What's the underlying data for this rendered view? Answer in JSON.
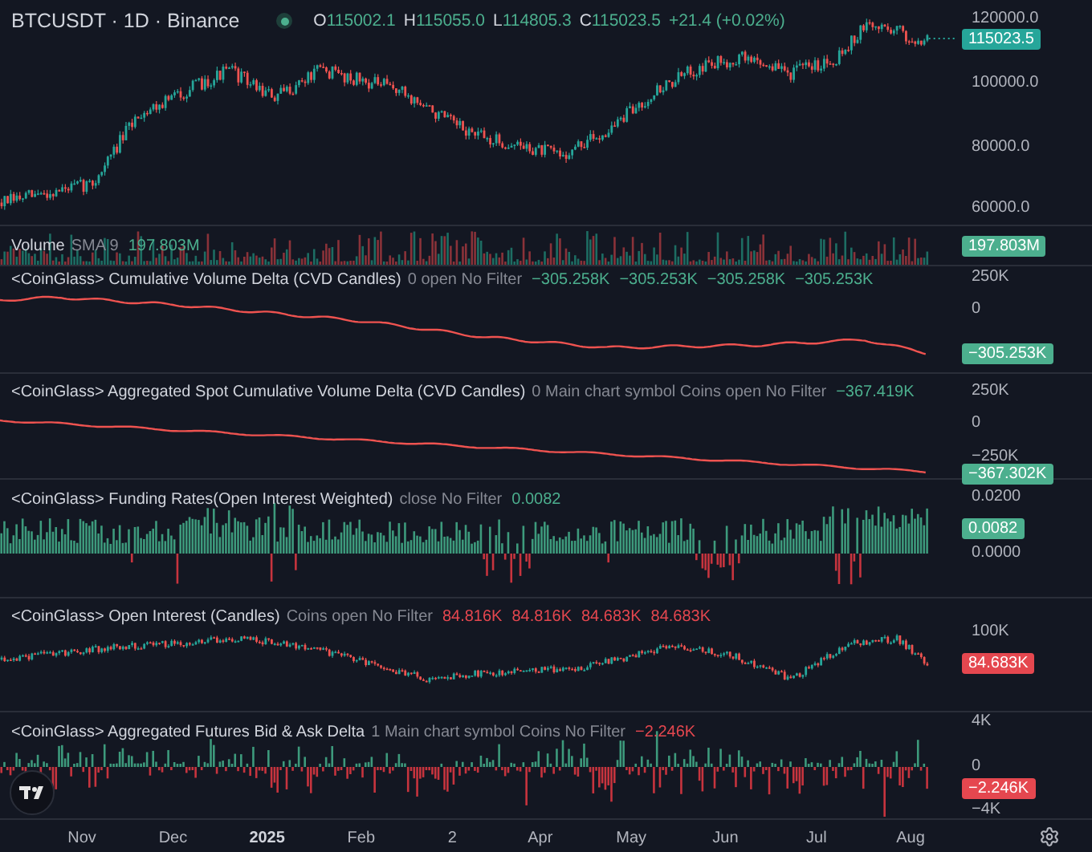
{
  "symbol": {
    "title": "BTCUSDT · 1D · Binance",
    "live": true,
    "ohlc": [
      {
        "label": "O",
        "value": "115002.1"
      },
      {
        "label": "H",
        "value": "115055.0"
      },
      {
        "label": "L",
        "value": "114805.3"
      },
      {
        "label": "C",
        "value": "115023.5"
      }
    ],
    "change": "+21.4 (+0.02%)",
    "color": "#4caf8e"
  },
  "price_axis": {
    "ticks": [
      "120000.0",
      "100000.0",
      "80000.0",
      "60000.0"
    ],
    "last_price": "115023.5"
  },
  "panes": [
    {
      "kind": "volume",
      "name": "Volume",
      "params": "SMA 9",
      "values": [
        "197.803M"
      ],
      "color": "#4caf8e",
      "badge": "197.803M"
    },
    {
      "kind": "cvd",
      "name": "<CoinGlass> Cumulative Volume Delta (CVD Candles)",
      "params": "0 open No Filter",
      "values": [
        "−305.258K",
        "−305.253K",
        "−305.258K",
        "−305.253K"
      ],
      "color": "#4caf8e",
      "ticks": [
        "250K",
        "0"
      ],
      "badge": "−305.253K"
    },
    {
      "kind": "spot_cvd",
      "name": "<CoinGlass> Aggregated Spot Cumulative Volume Delta (CVD Candles)",
      "params": "0 Main chart symbol Coins open No Filter",
      "values": [
        "−367.419K"
      ],
      "color": "#4caf8e",
      "ticks": [
        "250K",
        "0",
        "−250K"
      ],
      "badge": "−367.302K"
    },
    {
      "kind": "funding",
      "name": "<CoinGlass> Funding Rates(Open Interest Weighted)",
      "params": "close No Filter",
      "values": [
        "0.0082"
      ],
      "color": "#4caf8e",
      "ticks": [
        "0.0200",
        "0.0000"
      ],
      "badge": "0.0082"
    },
    {
      "kind": "open_interest",
      "name": "<CoinGlass> Open Interest (Candles)",
      "params": "Coins open No Filter",
      "values": [
        "84.816K",
        "84.816K",
        "84.683K",
        "84.683K"
      ],
      "color": "#e5474f",
      "ticks": [
        "100K"
      ],
      "badge": "84.683K"
    },
    {
      "kind": "bid_ask",
      "name": "<CoinGlass> Aggregated Futures Bid & Ask Delta",
      "params": "1 Main chart symbol Coins No Filter",
      "values": [
        "−2.246K"
      ],
      "color": "#e5474f",
      "ticks": [
        "4K",
        "0",
        "−4K"
      ],
      "badge": "−2.246K"
    }
  ],
  "time_axis": [
    {
      "label": "Nov",
      "bold": false
    },
    {
      "label": "Dec",
      "bold": false
    },
    {
      "label": "2025",
      "bold": true
    },
    {
      "label": "Feb",
      "bold": false
    },
    {
      "label": "2",
      "bold": false
    },
    {
      "label": "Apr",
      "bold": false
    },
    {
      "label": "May",
      "bold": false
    },
    {
      "label": "Jun",
      "bold": false
    },
    {
      "label": "Jul",
      "bold": false
    },
    {
      "label": "Aug",
      "bold": false
    }
  ]
}
